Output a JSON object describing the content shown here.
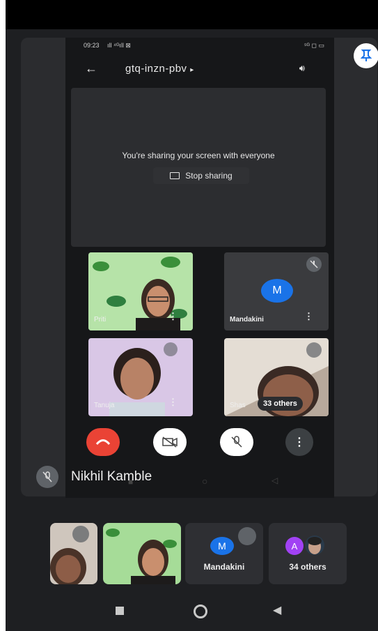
{
  "status_bar": {
    "time": "09:23",
    "left_icons": "ıll ⁴ᴳıll ⊠",
    "right_icons": "⁵ᴳ ◻ ▭"
  },
  "meeting": {
    "code": "gtq-inzn-pbv",
    "code_arrow": "▸"
  },
  "share": {
    "message": "You're sharing your screen with everyone",
    "stop_label": "Stop sharing"
  },
  "tiles": [
    {
      "name": "Priti",
      "menu": "⋮"
    },
    {
      "name": "Mandakini",
      "initial": "M",
      "menu": "⋮"
    },
    {
      "name": "Tanuja",
      "menu": "⋮"
    },
    {
      "name": "Shas",
      "others": "33 others"
    }
  ],
  "controls": {
    "end_call": "end-call",
    "camera": "camera-off",
    "mic": "mic-off",
    "more": "⋮"
  },
  "presenter": {
    "name": "Nikhil Kamble"
  },
  "strip": {
    "mandakini": {
      "initial": "M",
      "name": "Mandakini"
    },
    "others": {
      "initial": "A",
      "label": "34 others"
    }
  },
  "colors": {
    "end_red": "#ea4335",
    "avatar_blue": "#1a73e8",
    "avatar_purple": "#a142f4",
    "pin_blue": "#1a73e8"
  }
}
